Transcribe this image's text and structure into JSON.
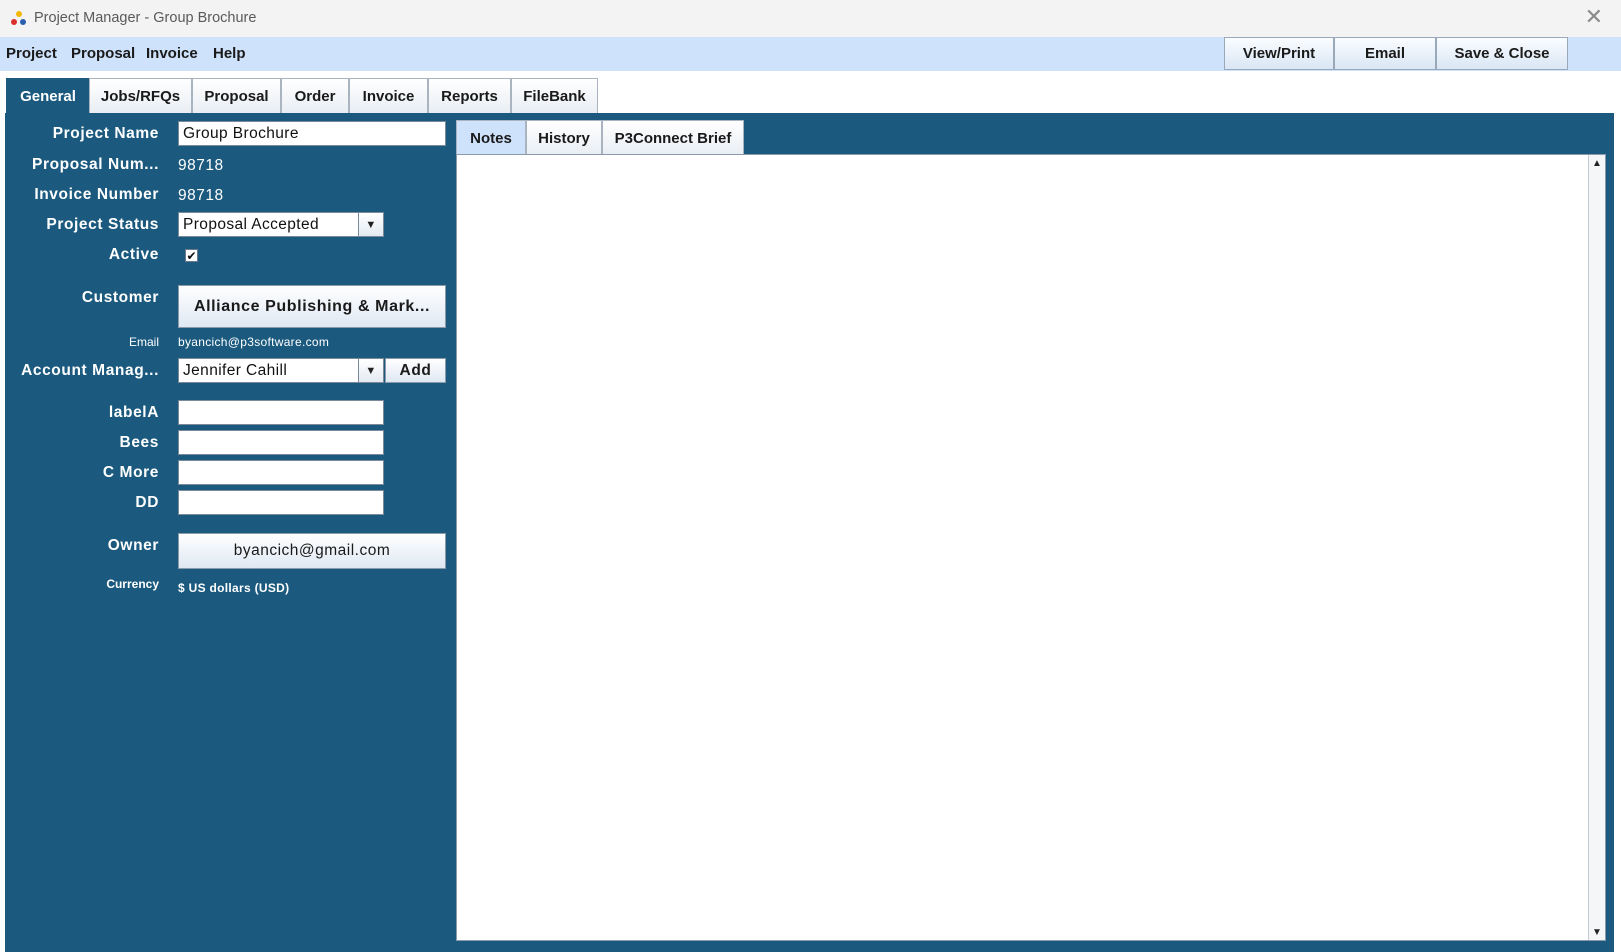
{
  "window": {
    "title": "Project Manager - Group Brochure",
    "close_glyph": "✕"
  },
  "menubar": {
    "items": [
      "Project",
      "Proposal",
      "Invoice",
      "Help"
    ],
    "buttons": [
      "View/Print",
      "Email",
      "Save & Close"
    ]
  },
  "tabs": [
    "General",
    "Jobs/RFQs",
    "Proposal",
    "Order",
    "Invoice",
    "Reports",
    "FileBank"
  ],
  "active_tab": "General",
  "form": {
    "project_name_label": "Project Name",
    "project_name_value": "Group Brochure",
    "proposal_num_label": "Proposal Num...",
    "proposal_num_value": "98718",
    "invoice_number_label": "Invoice Number",
    "invoice_number_value": "98718",
    "project_status_label": "Project Status",
    "project_status_value": "Proposal Accepted",
    "active_label": "Active",
    "active_checked": true,
    "active_check_glyph": "✔",
    "customer_label": "Customer",
    "customer_value": "Alliance Publishing & Mark...",
    "email_label": "Email",
    "email_value": "byancich@p3software.com",
    "account_manager_label": "Account Manag...",
    "account_manager_value": "Jennifer Cahill",
    "add_button": "Add",
    "labelA_label": "labelA",
    "labelA_value": "",
    "bees_label": "Bees",
    "bees_value": "",
    "c_more_label": "C More",
    "c_more_value": "",
    "dd_label": "DD",
    "dd_value": "",
    "owner_label": "Owner",
    "owner_value": "byancich@gmail.com",
    "currency_label": "Currency",
    "currency_value": "$ US dollars (USD)"
  },
  "subtabs": [
    "Notes",
    "History",
    "P3Connect Brief"
  ],
  "active_subtab": "Notes",
  "colors": {
    "panel": "#1b5a7e",
    "menubar": "#cfe2fb",
    "titlebar": "#f3f3f3"
  },
  "icons": {
    "app": "app-logo-icon",
    "close": "close-icon",
    "dropdown": "chevron-down-icon",
    "scroll_up": "scroll-up-arrow-icon",
    "scroll_down": "scroll-down-arrow-icon"
  }
}
